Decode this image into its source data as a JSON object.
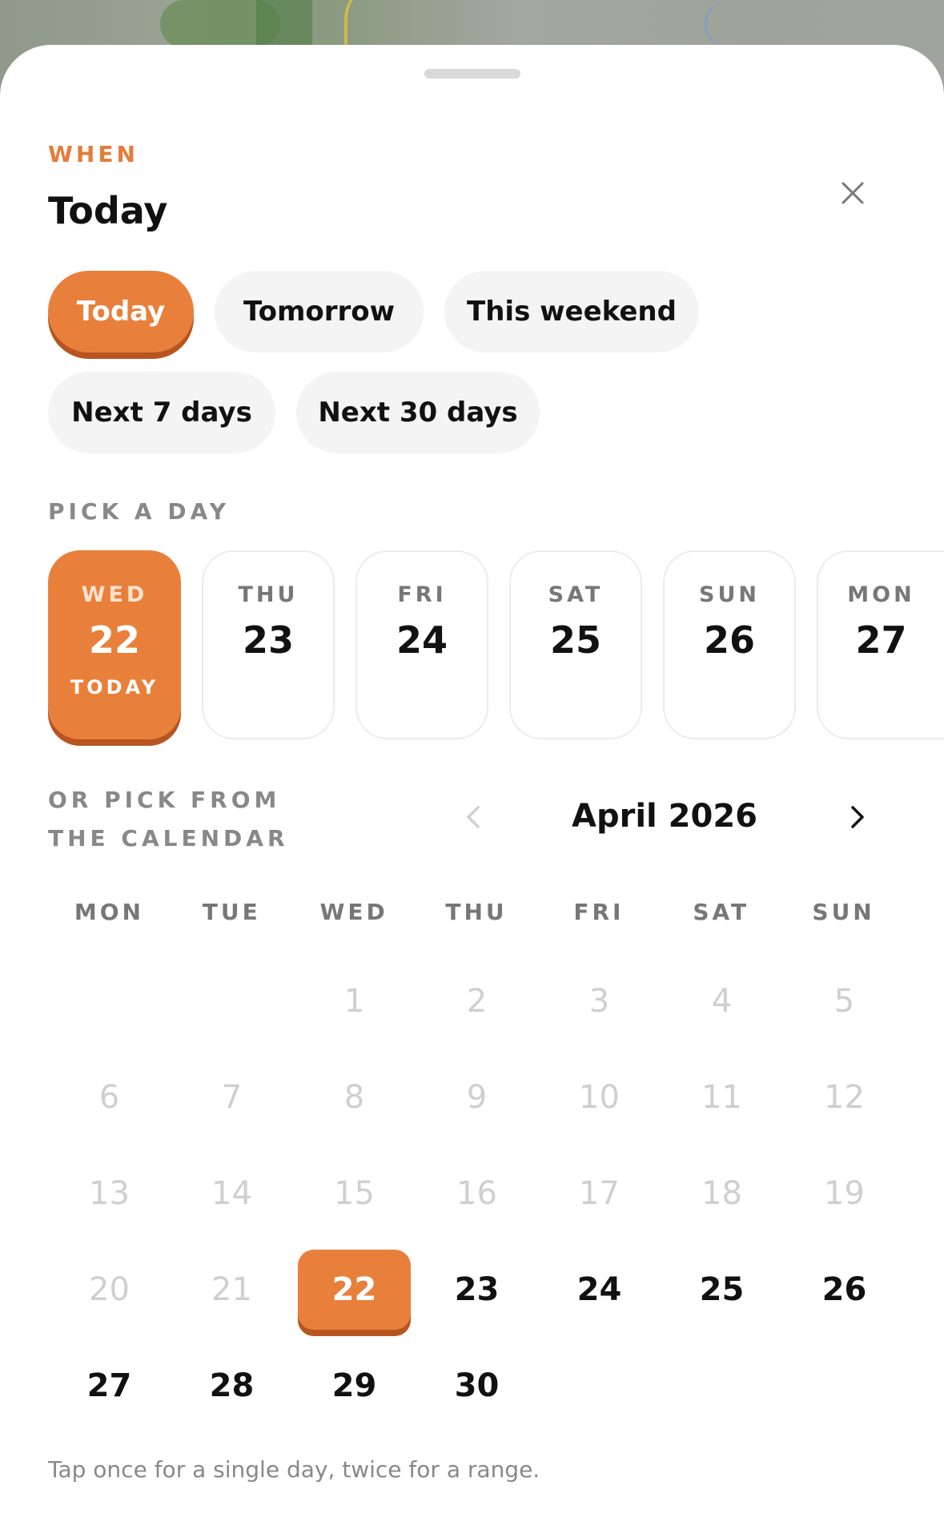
{
  "header": {
    "eyebrow": "WHEN",
    "title": "Today"
  },
  "quick_options": [
    {
      "label": "Today",
      "selected": true
    },
    {
      "label": "Tomorrow",
      "selected": false
    },
    {
      "label": "This weekend",
      "selected": false
    },
    {
      "label": "Next 7 days",
      "selected": false
    },
    {
      "label": "Next 30 days",
      "selected": false
    }
  ],
  "day_picker": {
    "label": "PICK A DAY",
    "days": [
      {
        "dow": "WED",
        "num": "22",
        "sub": "TODAY",
        "selected": true
      },
      {
        "dow": "THU",
        "num": "23",
        "sub": "",
        "selected": false
      },
      {
        "dow": "FRI",
        "num": "24",
        "sub": "",
        "selected": false
      },
      {
        "dow": "SAT",
        "num": "25",
        "sub": "",
        "selected": false
      },
      {
        "dow": "SUN",
        "num": "26",
        "sub": "",
        "selected": false
      },
      {
        "dow": "MON",
        "num": "27",
        "sub": "",
        "selected": false
      }
    ]
  },
  "calendar": {
    "label": "OR PICK FROM THE CALENDAR",
    "month": "April 2026",
    "weekdays": [
      "MON",
      "TUE",
      "WED",
      "THU",
      "FRI",
      "SAT",
      "SUN"
    ],
    "weeks": [
      [
        "",
        "",
        "1",
        "2",
        "3",
        "4",
        "5"
      ],
      [
        "6",
        "7",
        "8",
        "9",
        "10",
        "11",
        "12"
      ],
      [
        "13",
        "14",
        "15",
        "16",
        "17",
        "18",
        "19"
      ],
      [
        "20",
        "21",
        "22",
        "23",
        "24",
        "25",
        "26"
      ],
      [
        "27",
        "28",
        "29",
        "30",
        "",
        "",
        ""
      ]
    ],
    "selected_day": "22",
    "first_selectable_day": 22
  },
  "hint": "Tap once for a single day, twice for a range.",
  "colors": {
    "accent": "#e8803c",
    "accent_shadow": "#b85420",
    "eyebrow": "#e57c3a"
  },
  "icons": {
    "close": "close-icon",
    "prev": "chevron-left-icon",
    "next": "chevron-right-icon"
  }
}
